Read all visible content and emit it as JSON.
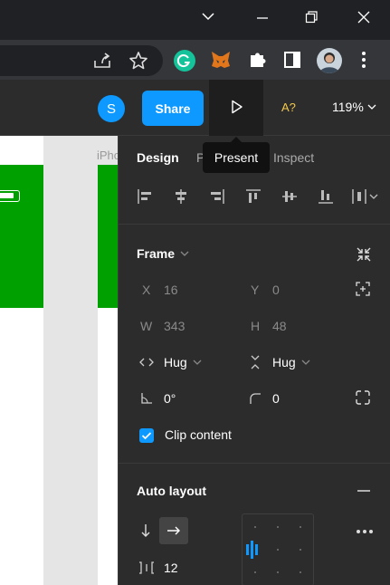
{
  "browser": {
    "window_controls": [
      "chevron-down-icon",
      "minimize-icon",
      "restore-icon",
      "close-icon"
    ],
    "toolbar_icons": [
      "share-page-icon",
      "bookmark-star-icon",
      "grammarly-icon",
      "metamask-icon",
      "extensions-puzzle-icon",
      "sidepanel-icon",
      "profile-avatar",
      "more-vert-icon"
    ]
  },
  "figma_bar": {
    "avatar_letter": "S",
    "share_label": "Share",
    "present_tooltip": "Present",
    "font_check_label": "A?",
    "zoom": "119%"
  },
  "canvas": {
    "frame_label": "iPho"
  },
  "panel": {
    "tabs": {
      "design": "Design",
      "prototype": "P",
      "inspect": "Inspect"
    },
    "frame": {
      "title": "Frame",
      "x_label": "X",
      "x_value": "16",
      "y_label": "Y",
      "y_value": "0",
      "w_label": "W",
      "w_value": "343",
      "h_label": "H",
      "h_value": "48",
      "width_mode": "Hug",
      "height_mode": "Hug",
      "rotation": "0°",
      "corner_radius": "0",
      "clip_content_label": "Clip content",
      "clip_content_checked": true
    },
    "auto_layout": {
      "title": "Auto layout",
      "spacing": "12"
    }
  },
  "colors": {
    "accent": "#0d99ff",
    "frame_green": "#00a000",
    "panel_bg": "#2c2c2c"
  }
}
